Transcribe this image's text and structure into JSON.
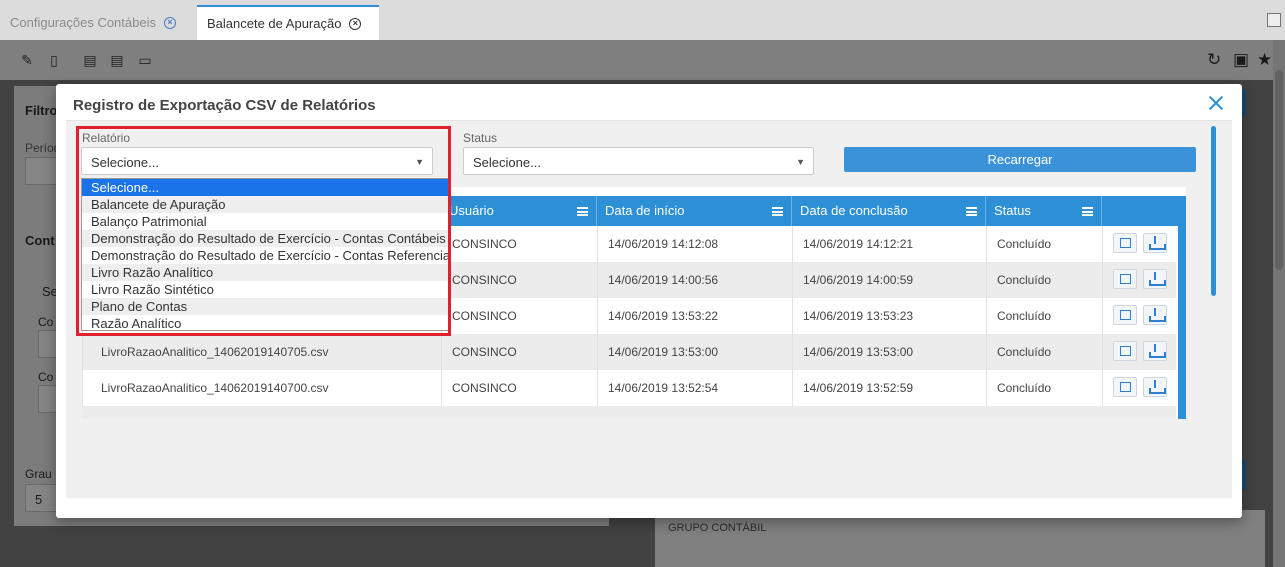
{
  "tabs": [
    {
      "label": "Configurações Contábeis"
    },
    {
      "label": "Balancete de Apuração"
    }
  ],
  "background": {
    "filter_title": "Filtro",
    "period_label": "Períod",
    "cont_title": "Cont",
    "se_label": "Se",
    "co_label1": "Co",
    "co_label2": "Co",
    "grau_label": "Grau",
    "grau_value": "5",
    "grupo_label": "GRUPO CONTÁBIL"
  },
  "modal": {
    "title": "Registro de Exportação CSV de Relatórios",
    "relatorio_label": "Relatório",
    "relatorio_value": "Selecione...",
    "status_label": "Status",
    "status_value": "Selecione...",
    "reload_label": "Recarregar"
  },
  "dropdown": {
    "options": [
      "Selecione...",
      "Balancete de Apuração",
      "Balanço Patrimonial",
      "Demonstração do Resultado de Exercício - Contas Contábeis",
      "Demonstração do Resultado de Exercício - Contas Referenciais",
      "Livro Razão Analítico",
      "Livro Razão Sintético",
      "Plano de Contas",
      "Razão Analítico"
    ]
  },
  "grid": {
    "columns": [
      "Usuário",
      "Data de início",
      "Data de conclusão",
      "Status"
    ],
    "rows": [
      {
        "file": "",
        "user": "CONSINCO",
        "start": "14/06/2019 14:12:08",
        "end": "14/06/2019 14:12:21",
        "status": "Concluído"
      },
      {
        "file": "",
        "user": "CONSINCO",
        "start": "14/06/2019 14:00:56",
        "end": "14/06/2019 14:00:59",
        "status": "Concluído"
      },
      {
        "file": "",
        "user": "CONSINCO",
        "start": "14/06/2019 13:53:22",
        "end": "14/06/2019 13:53:23",
        "status": "Concluído"
      },
      {
        "file": "LivroRazaoAnalitico_14062019140705.csv",
        "user": "CONSINCO",
        "start": "14/06/2019 13:53:00",
        "end": "14/06/2019 13:53:00",
        "status": "Concluído"
      },
      {
        "file": "LivroRazaoAnalitico_14062019140700.csv",
        "user": "CONSINCO",
        "start": "14/06/2019 13:52:54",
        "end": "14/06/2019 13:52:59",
        "status": "Concluído"
      }
    ]
  },
  "colors": {
    "accent": "#2d8fd5",
    "highlight": "#e0202e",
    "dropdown_selected": "#1a73e8"
  }
}
